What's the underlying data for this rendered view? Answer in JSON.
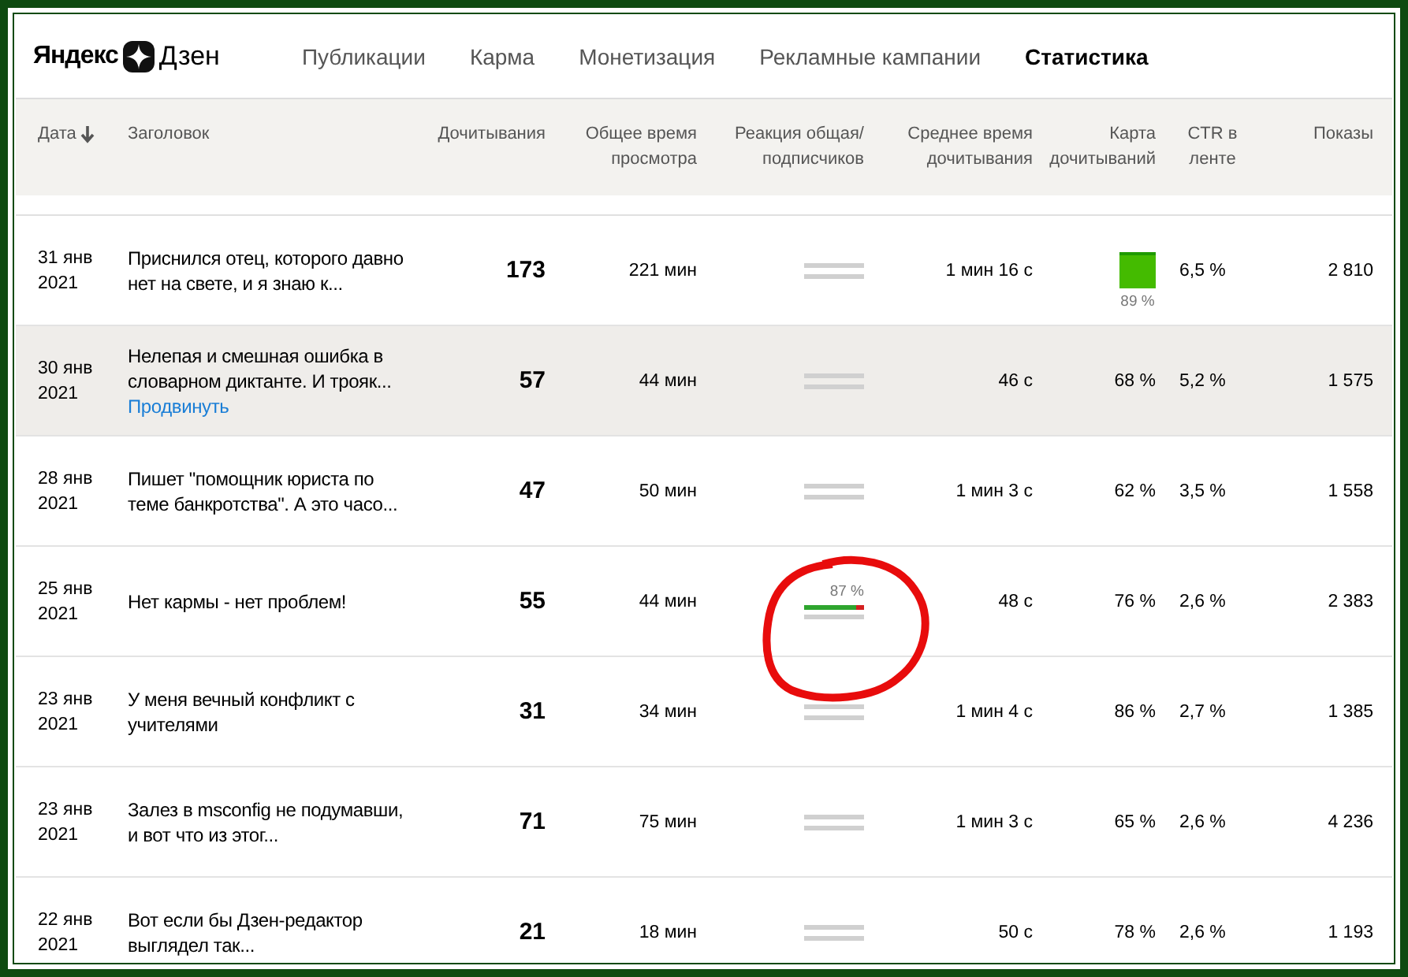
{
  "logo": {
    "brand": "Яндекс",
    "product": "Дзен"
  },
  "nav": [
    {
      "label": "Публикации",
      "selected": false
    },
    {
      "label": "Карма",
      "selected": false
    },
    {
      "label": "Монетизация",
      "selected": false
    },
    {
      "label": "Рекламные кампании",
      "selected": false
    },
    {
      "label": "Статистика",
      "selected": true
    }
  ],
  "table": {
    "columns": [
      {
        "label": "Дата",
        "sorted": true
      },
      {
        "label": "Заголовок",
        "sorted": false
      },
      {
        "label": "Дочитывания",
        "sorted": false
      },
      {
        "label": "Общее время просмотра",
        "sorted": false
      },
      {
        "label": "Реакция общая/ подписчиков",
        "sorted": false
      },
      {
        "label": "Среднее время дочитывания",
        "sorted": false
      },
      {
        "label": "Карта дочитываний",
        "sorted": false
      },
      {
        "label": "CTR в ленте",
        "sorted": false
      },
      {
        "label": "Показы",
        "sorted": false
      }
    ],
    "rows": [
      {
        "date": "31 янв",
        "year": "2021",
        "title": "Приснился отец, которого давно нет на свете, и я знаю к...",
        "highlighted": false,
        "reads": "173",
        "total_time": "221 мин",
        "reaction": {
          "kind": "empty"
        },
        "avg_time": "1 мин 16 с",
        "map": {
          "kind": "square",
          "label": "89 %"
        },
        "ctr": "6,5 %",
        "shows": "2 810"
      },
      {
        "date": "30 янв",
        "year": "2021",
        "title": "Нелепая и смешная ошибка в словарном диктанте. И трояк...",
        "highlighted": true,
        "promote_link": "Продвинуть",
        "reads": "57",
        "total_time": "44 мин",
        "reaction": {
          "kind": "empty"
        },
        "avg_time": "46 с",
        "map": {
          "kind": "text",
          "label": "68 %"
        },
        "ctr": "5,2 %",
        "shows": "1 575"
      },
      {
        "date": "28 янв",
        "year": "2021",
        "title": "Пишет \"помощник юриста по теме банкротства\". А это часо...",
        "highlighted": false,
        "reads": "47",
        "total_time": "50 мин",
        "reaction": {
          "kind": "empty"
        },
        "avg_time": "1 мин 3 с",
        "map": {
          "kind": "text",
          "label": "62 %"
        },
        "ctr": "3,5 %",
        "shows": "1 558"
      },
      {
        "date": "25 янв",
        "year": "2021",
        "title": "Нет кармы - нет проблем!",
        "highlighted": false,
        "reads": "55",
        "total_time": "44 мин",
        "reaction": {
          "kind": "bar",
          "level": 0.87,
          "label": "87 %",
          "circled": true
        },
        "avg_time": "48 с",
        "map": {
          "kind": "text",
          "label": "76 %"
        },
        "ctr": "2,6 %",
        "shows": "2 383"
      },
      {
        "date": "23 янв",
        "year": "2021",
        "title": "У меня вечный конфликт с учителями",
        "highlighted": false,
        "reads": "31",
        "total_time": "34 мин",
        "reaction": {
          "kind": "empty"
        },
        "avg_time": "1 мин 4 с",
        "map": {
          "kind": "text",
          "label": "86 %"
        },
        "ctr": "2,7 %",
        "shows": "1 385"
      },
      {
        "date": "23 янв",
        "year": "2021",
        "title": "Залез в msconfig не подумавши, и вот что из этог...",
        "highlighted": false,
        "reads": "71",
        "total_time": "75 мин",
        "reaction": {
          "kind": "empty"
        },
        "avg_time": "1 мин 3 с",
        "map": {
          "kind": "text",
          "label": "65 %"
        },
        "ctr": "2,6 %",
        "shows": "4 236"
      },
      {
        "date": "22 янв",
        "year": "2021",
        "title": "Вот если бы Дзен-редактор выглядел так...",
        "highlighted": false,
        "reads": "21",
        "total_time": "18 мин",
        "reaction": {
          "kind": "empty"
        },
        "avg_time": "50 с",
        "map": {
          "kind": "text",
          "label": "78 %"
        },
        "ctr": "2,6 %",
        "shows": "1 193"
      }
    ]
  }
}
